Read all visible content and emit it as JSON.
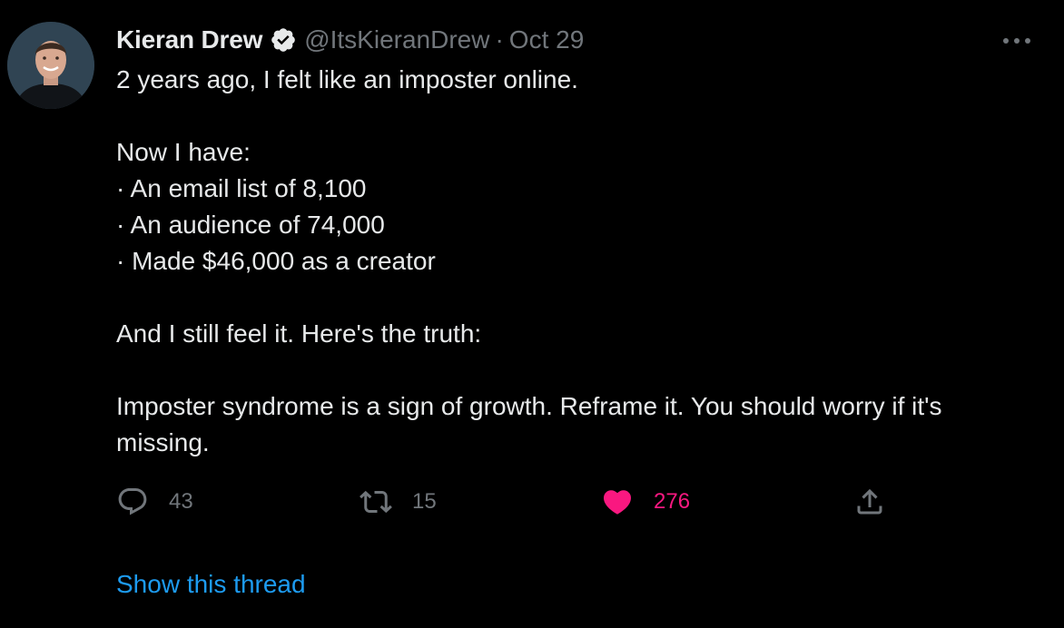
{
  "author": {
    "display_name": "Kieran Drew",
    "handle": "@ItsKieranDrew",
    "verified": true,
    "avatar_icon": "person-avatar"
  },
  "meta": {
    "separator": "·",
    "date": "Oct 29"
  },
  "tweet_lines": [
    "2 years ago, I felt like an imposter online.",
    "",
    "Now I have:",
    "· An email list of 8,100",
    "· An audience of 74,000",
    "· Made $46,000 as a creator",
    "",
    "And I still feel it.  Here's the truth:",
    "",
    "Imposter syndrome is a sign of growth.  Reframe it. You should worry if it's missing."
  ],
  "actions": {
    "reply": {
      "icon": "reply-icon",
      "count": "43"
    },
    "retweet": {
      "icon": "retweet-icon",
      "count": "15"
    },
    "like": {
      "icon": "heart-icon",
      "count": "276",
      "active": true
    },
    "share": {
      "icon": "share-icon"
    }
  },
  "show_thread_label": "Show this thread",
  "colors": {
    "background": "#000000",
    "text_primary": "#e7e9ea",
    "text_secondary": "#71767b",
    "verified_badge": "#e7e9ea",
    "like_active": "#f91880",
    "link": "#1d9bf0"
  }
}
